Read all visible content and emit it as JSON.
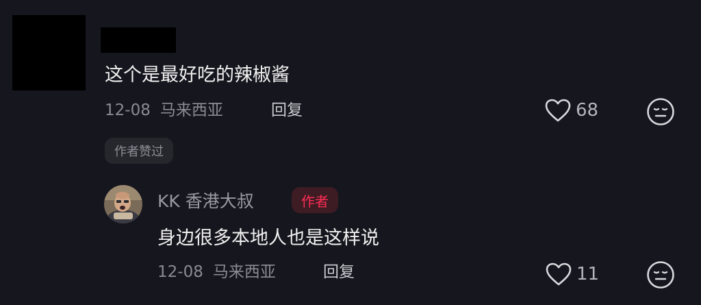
{
  "comment": {
    "text": "这个是最好吃的辣椒酱",
    "date": "12-08",
    "location": "马来西亚",
    "reply_label": "回复",
    "like_count": "68",
    "author_liked_label": "作者赞过"
  },
  "reply": {
    "username": "KK 香港大叔",
    "author_badge": "作者",
    "text": "身边很多本地人也是这样说",
    "date": "12-08",
    "location": "马来西亚",
    "reply_label": "回复",
    "like_count": "11"
  },
  "icons": {
    "like": "heart-icon",
    "reaction": "neutral-face-icon"
  },
  "colors": {
    "background": "#16161e",
    "author_badge_text": "#fe2c55",
    "author_badge_bg": "#3d1c24"
  }
}
